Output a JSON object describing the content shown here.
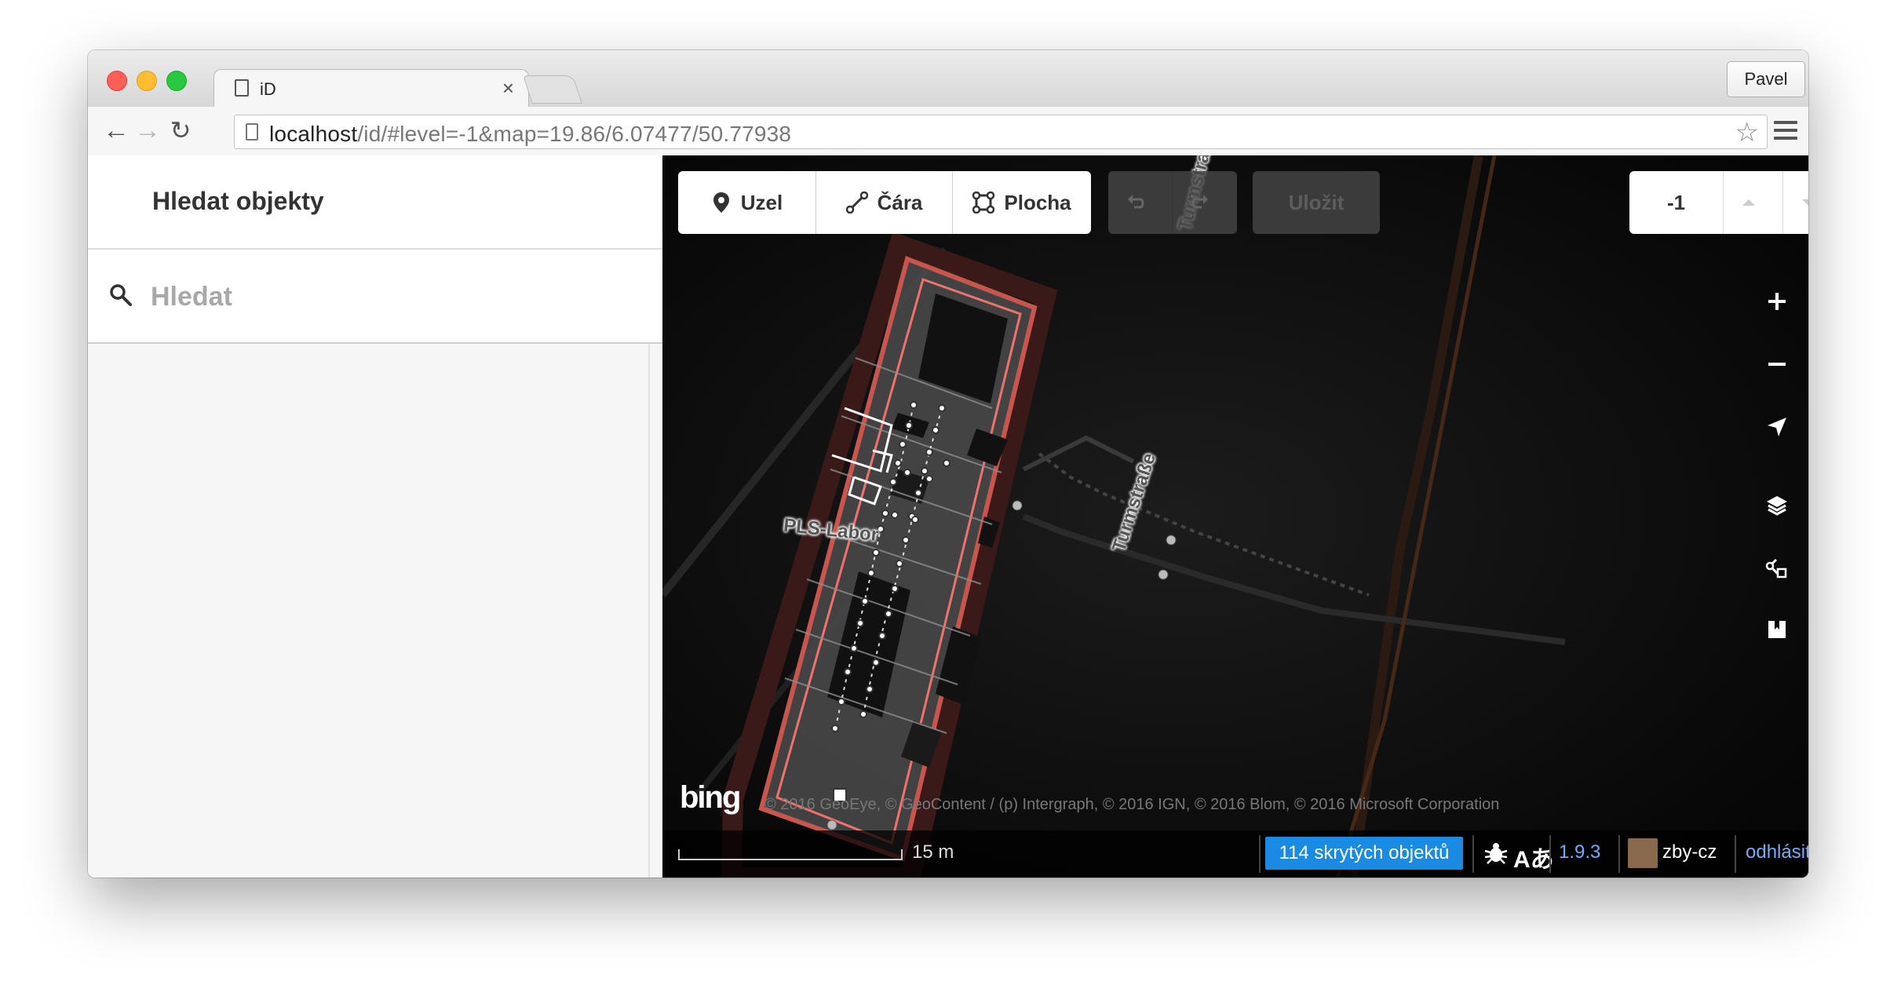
{
  "browser": {
    "tab_title": "iD",
    "tab_close": "×",
    "profile": "Pavel",
    "url_host": "localhost",
    "url_rest": "/id/#level=-1&map=19.86/6.07477/50.77938"
  },
  "sidebar": {
    "title": "Hledat objekty",
    "search_placeholder": "Hledat"
  },
  "map": {
    "toolbar": {
      "node_label": "Uzel",
      "line_label": "Čára",
      "area_label": "Plocha",
      "save_label": "Uložit"
    },
    "level": {
      "value": "-1",
      "close": "✕"
    },
    "labels": {
      "building": "PLS-Labor",
      "street_top": "Turmstraße",
      "street_bottom": "Turmstraße"
    },
    "attribution": "© 2016 GeoEye, © GeoContent / (p) Intergraph, © 2016 IGN, © 2016 Blom, © 2016 Microsoft Corporation",
    "bing_logo": "bing",
    "scale": "15 m",
    "footer": {
      "hidden_features": "114 skrytých objektů",
      "translate_icon": "Aあ",
      "version": "1.9.3",
      "user": "zby-cz",
      "logout": "odhlásit"
    },
    "colors": {
      "accent": "#1b8ae2",
      "link": "#7aaaf6",
      "building_outline": "#f0726c"
    }
  }
}
